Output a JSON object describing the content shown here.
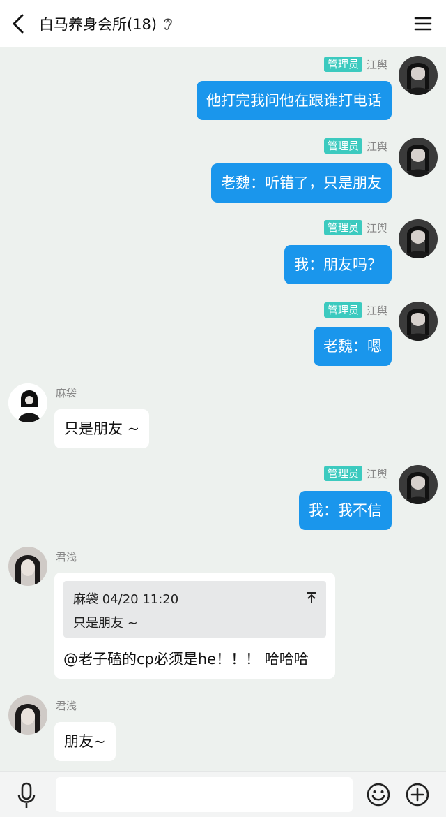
{
  "header": {
    "title": "白马养身会所(18)",
    "back_icon": "chevron-left-icon",
    "ear_icon": "ear-icon",
    "menu_icon": "hamburger-menu-icon"
  },
  "colors": {
    "outgoing_bubble": "#1a96ec",
    "admin_badge": "#3ccabf",
    "chat_background": "#edf1ee"
  },
  "messages": [
    {
      "sender": "江舆",
      "badge": "管理员",
      "direction": "out",
      "text": "他打完我问他在跟谁打电话"
    },
    {
      "sender": "江舆",
      "badge": "管理员",
      "direction": "out",
      "text": "老魏：听错了，只是朋友"
    },
    {
      "sender": "江舆",
      "badge": "管理员",
      "direction": "out",
      "text": "我：朋友吗？"
    },
    {
      "sender": "江舆",
      "badge": "管理员",
      "direction": "out",
      "text": "老魏：嗯"
    },
    {
      "sender": "麻袋",
      "direction": "in",
      "text": "只是朋友 ~"
    },
    {
      "sender": "江舆",
      "badge": "管理员",
      "direction": "out",
      "text": "我：我不信"
    },
    {
      "sender": "君浅",
      "direction": "in",
      "quote": {
        "author_time": "麻袋 04/20 11:20",
        "text": "只是朋友 ~"
      },
      "text": "@老子磕的cp必须是he！！！ 哈哈哈"
    },
    {
      "sender": "君浅",
      "direction": "in",
      "text": "朋友~"
    }
  ],
  "composer": {
    "input_value": "",
    "mic_icon": "microphone-icon",
    "emoji_icon": "smiley-icon",
    "plus_icon": "plus-circle-icon"
  }
}
